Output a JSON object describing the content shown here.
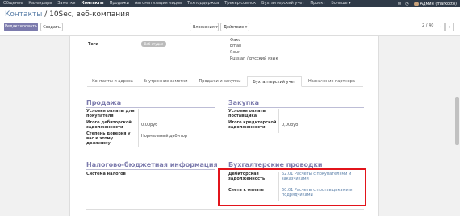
{
  "topnav": {
    "items": [
      "Общение",
      "Календарь",
      "Заметки",
      "Контакты",
      "Продажи",
      "Автоматизация лидов",
      "Техподдержка",
      "Трекер ссылок",
      "Бухгалтерский учет",
      "Проект",
      "Больше ▾"
    ],
    "active_index": 3,
    "user": "Админ (markotto)"
  },
  "breadcrumb": {
    "parent": "Контакты",
    "sep": " / ",
    "current": "10Sec, веб-компания"
  },
  "toolbar": {
    "edit": "Редактировать",
    "create": "Создать",
    "attachments": "Вложения ▾",
    "actions": "Действие ▾",
    "pager": "2 / 40",
    "prev": "‹",
    "next": "›"
  },
  "header": {
    "tags_label": "Теги",
    "tag_pill": "Веб студия",
    "contact_fields": [
      "Факс",
      "Email",
      "Язык",
      "Russian / русский язык"
    ]
  },
  "tabs": [
    "Контакты и адреса",
    "Внутренние заметки",
    "Продажи и закупки",
    "Бухгалтерский учет",
    "Назначение партнера"
  ],
  "active_tab": 3,
  "sales": {
    "title": "Продажа",
    "payment_terms_label": "Условия оплаты для покупателя",
    "receivable_total_label": "Итого дебиторской задолженности",
    "receivable_total_value": "0,00руб",
    "trust_label": "Степень доверия у вас к этому должнику",
    "trust_value": "Нормальный дебитор"
  },
  "purchase": {
    "title": "Закупка",
    "payment_terms_label": "Условия оплаты поставщика",
    "payable_total_label": "Итого кредиторской задолженности",
    "payable_total_value": "0,00руб"
  },
  "fiscal": {
    "title": "Налогово-бюджетная информация",
    "tax_system_label": "Система налогов"
  },
  "accounting": {
    "title": "Бухгалтерские проводки",
    "receivable_label": "Дебиторская задолженность",
    "receivable_value": "62.01 Расчеты с покупателями и заказчиками",
    "payable_label": "Счета к оплате",
    "payable_value": "60.01 Расчеты с поставщиками и подрядчиками"
  },
  "colors": {
    "nav_bg": "#2f3a48",
    "accent": "#7c7bad",
    "link": "#5a7fa8",
    "highlight": "#e2141b"
  }
}
